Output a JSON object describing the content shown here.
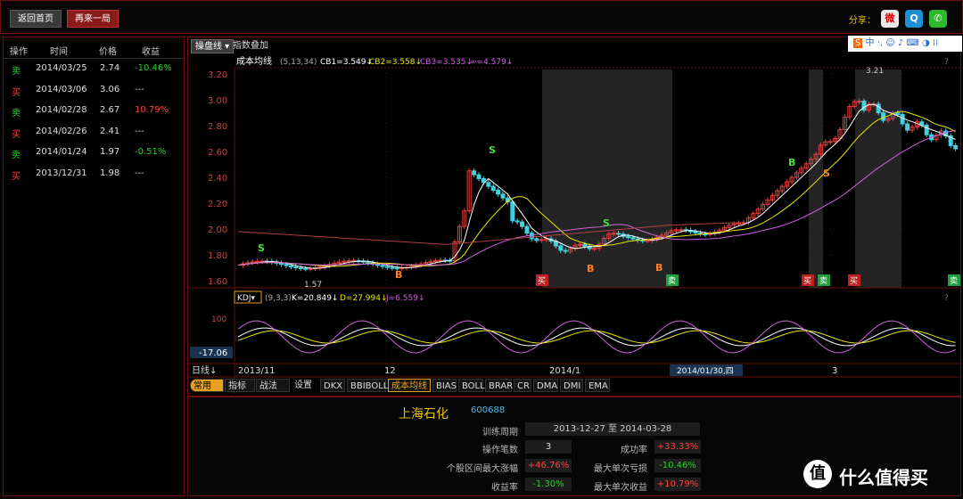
{
  "topbar": {
    "home": "返回首页",
    "again": "再来一局",
    "share": "分享："
  },
  "side": {
    "headers": {
      "op": "操作",
      "time": "时间",
      "price": "价格",
      "gain": "收益"
    },
    "rows": [
      {
        "op": "卖",
        "time": "2014/03/25",
        "price": "2.74",
        "gain": "-10.46%",
        "op_color": "#21d321",
        "gain_color": "#21d321"
      },
      {
        "op": "买",
        "time": "2014/03/06",
        "price": "3.06",
        "gain": "---",
        "op_color": "#ff4040",
        "gain_color": "#ccc"
      },
      {
        "op": "卖",
        "time": "2014/02/28",
        "price": "2.67",
        "gain": "10.79%",
        "op_color": "#21d321",
        "gain_color": "#ff4040"
      },
      {
        "op": "买",
        "time": "2014/02/26",
        "price": "2.41",
        "gain": "---",
        "op_color": "#ff4040",
        "gain_color": "#ccc"
      },
      {
        "op": "卖",
        "time": "2014/01/24",
        "price": "1.97",
        "gain": "-0.51%",
        "op_color": "#21d321",
        "gain_color": "#21d321"
      },
      {
        "op": "买",
        "time": "2013/12/31",
        "price": "1.98",
        "gain": "---",
        "op_color": "#ff4040",
        "gain_color": "#ccc"
      }
    ]
  },
  "chart": {
    "tab_main": "操盘线",
    "tab_overlay": "指数叠加",
    "ind_name": "成本均线",
    "ind_params": "(5,13,34)",
    "cb1": "CB1=3.549",
    "cb2": "CB2=3.558",
    "cb3": "CB3=3.535",
    "cbinf": "∞=4.579",
    "kdj_name": "KDJ",
    "kdj_params": "(9,3,3)",
    "k": "K=20.849",
    "d": "D=27.994",
    "j": "J=6.559",
    "kdj_level": "100",
    "kdj_readout": "-17.06",
    "yticks": [
      "3.20",
      "3.00",
      "2.80",
      "2.60",
      "2.40",
      "2.20",
      "2.00",
      "1.80",
      "1.60"
    ],
    "high_label": "3.21",
    "low_label": "1.57",
    "x_period": "日线",
    "xlabels": [
      "2013/11",
      "12",
      "2014/1",
      "3"
    ],
    "cursor_date": "2014/01/30,四",
    "trade_markers": [
      "买",
      "卖",
      "买",
      "卖",
      "买",
      "卖"
    ],
    "signals": [
      "S",
      "B",
      "S",
      "B",
      "S",
      "B",
      "B",
      "S"
    ]
  },
  "toolbar": {
    "common": "常用",
    "indicator": "指标",
    "tactic": "战法",
    "settings": "设置",
    "tabs": [
      "DKX",
      "BBIBOLL",
      "成本均线",
      "BIAS",
      "BOLL",
      "BRAR",
      "CR",
      "DMA",
      "DMI",
      "EMA"
    ]
  },
  "stock": {
    "name": "上海石化",
    "code": "600688",
    "period_label": "训练周期",
    "period": "2013-12-27 至 2014-03-28",
    "trades_label": "操作笔数",
    "trades": "3",
    "win_label": "成功率",
    "win": "+33.33%",
    "maxrise_label": "个股区间最大涨幅",
    "maxrise": "+46.76%",
    "maxloss_label": "最大单次亏损",
    "maxloss": "-10.46%",
    "ret_label": "收益率",
    "ret": "-1.30%",
    "maxgain_label": "最大单次收益",
    "maxgain": "+10.79%"
  },
  "watermark": "什么值得买"
}
